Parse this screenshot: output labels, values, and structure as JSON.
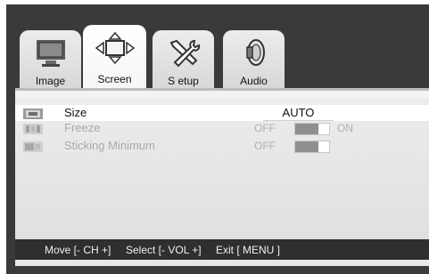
{
  "tabs": [
    {
      "label": "Image",
      "icon": "monitor-icon",
      "active": false
    },
    {
      "label": "Screen",
      "icon": "screen-arrows-icon",
      "active": true
    },
    {
      "label": "S etup",
      "icon": "tools-icon",
      "active": false
    },
    {
      "label": "Audio",
      "icon": "speaker-icon",
      "active": false
    }
  ],
  "menu": {
    "size": {
      "label": "Size",
      "value": "AUTO",
      "icon": "aspect-ratio-icon"
    },
    "freeze": {
      "label": "Freeze",
      "off_label": "OFF",
      "on_label": "ON",
      "state": "off",
      "icon": "freeze-icon"
    },
    "sticking": {
      "label": "Sticking Minimum",
      "off_label": "OFF",
      "state": "off",
      "icon": "sticking-icon"
    }
  },
  "help": {
    "move": "Move [- CH +]",
    "select": "Select [- VOL +]",
    "exit": "Exit [ MENU ]"
  },
  "colors": {
    "background": "#3a3a3a",
    "panel": "#ececec",
    "selected_row": "#ffffff",
    "help_bar": "#2f2f2f"
  }
}
